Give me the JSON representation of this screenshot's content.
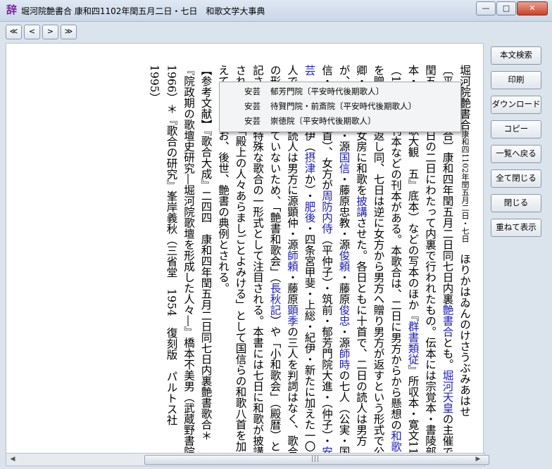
{
  "window": {
    "app_icon": "辞",
    "title": "堀河院艶書合 康和四1102年閏五月二日・七日　和歌文学大事典",
    "controls": {
      "minimize": "—",
      "maximize": "□",
      "close": "✕"
    }
  },
  "nav": {
    "first": "≪",
    "prev": "<",
    "next": ">",
    "last": "≫"
  },
  "sidebar": {
    "buttons": [
      "本文検索",
      "印刷",
      "ダウンロード",
      "コピー",
      "一覧へ戻る",
      "全て閉じる",
      "閉じる",
      "重ねて表示"
    ]
  },
  "popup": {
    "items": [
      {
        "author": "安芸",
        "label": "郁芳門院〔平安時代後期歌人〕"
      },
      {
        "author": "安芸",
        "label": "待賢門院・前斎院〔平安時代後期歌人〕"
      },
      {
        "author": "安芸",
        "label": "崇徳院〔平安時代後期歌人〕"
      }
    ]
  },
  "article": {
    "heading_main": "堀河院艶書合",
    "heading_sub": "康和四1102年閏五月二日・七日",
    "heading_reading": "ほりかはゐんのけさうぶみあはせ",
    "bracket": "〔平安後期歌合〕",
    "col1_a": "康和四年閏五月二日同七日内裏",
    "col1_link1": "艶書合",
    "col1_b": "とも。",
    "col1_link2": "堀河天皇",
    "col1_c": "の主催で閏五月二日七日の二日にわたって内裏で行われたもの。伝本には宗覚本・書陵部本・",
    "col1_d": "『新編国歌大観　五』底本）などの写本のほか『",
    "col1_link3": "群書類従",
    "col1_e": "』所収本・寛文11（1683）年刊本などの刊本がある。本歌合は、二日に男方からから懸想の",
    "col1_link4": "和歌",
    "col1_f": "を贈り女方が返し同、七日は逆に女方から男方へ贈り男方が返すという形式で公卿・殿上人・女房に和歌を",
    "col1_link5": "披講",
    "col1_g": "させた。各日ともに十首で、二日の読人は男方が、藤原",
    "col1_link6": "公実",
    "col1_h": "・源",
    "col1_link7": "国信",
    "col1_i": "・藤原忠教・源",
    "col1_link8": "俊頼",
    "col1_j": "・藤原",
    "col1_link9": "俊忠",
    "col1_k": "・源",
    "col1_link10": "師時",
    "col1_l": "の七人（公実・国信・忠教各二首）、女方が",
    "col1_link11": "周防内侍",
    "col1_m": "（平仲子）・筑前・郁芳門院大進・（仲子）・",
    "col1_link12": "安芸",
    "col1_n": "（合花・紀伊（",
    "col1_link13": "摂津",
    "col1_o": "か）・",
    "col1_link14": "肥後",
    "col1_p": "・四条宮甲斐・上総・紀伊・新たに加えた一〇人で、七日の読人は男方に源顕仲・源",
    "col1_link15": "師頼",
    "col1_q": "・藤原",
    "col1_link16": "顕季",
    "col1_r": "の三人を判詞はなく、歌合の形式を備えていないため、「艶書和歌会」（",
    "col1_link17": "長秋記",
    "col1_s": "）や「小和歌会」（殿暦）と記されるが、特殊な歌合の一形式として注目される。本書には七日に和歌が披講されたのち、「殿上の人々あらましごとよみける」として国信らの和歌八首を加えている。なお、後世、艶書の典例とされる。",
    "refs_a": "【参考文献】『歌合大成』二四四　康和四年閏五月二日同七日内裏艶書歌合＊『院政期の歌壇史研究―堀河院歌壇を形成した人々―』橋本不美男（武蔵野書院　1966）＊『歌合の研究』峯岸義秋（三省堂　1954　復刻版　パルトス社　1995）"
  }
}
